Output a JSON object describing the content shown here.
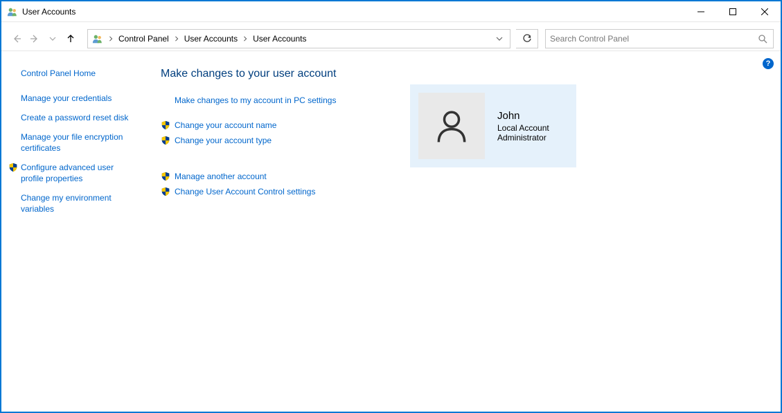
{
  "window": {
    "title": "User Accounts"
  },
  "breadcrumb": {
    "items": [
      "Control Panel",
      "User Accounts",
      "User Accounts"
    ]
  },
  "search": {
    "placeholder": "Search Control Panel"
  },
  "sidebar": {
    "home": "Control Panel Home",
    "links": [
      {
        "label": "Manage your credentials",
        "shield": false
      },
      {
        "label": "Create a password reset disk",
        "shield": false
      },
      {
        "label": "Manage your file encryption certificates",
        "shield": false
      },
      {
        "label": "Configure advanced user profile properties",
        "shield": true
      },
      {
        "label": "Change my environment variables",
        "shield": false
      }
    ]
  },
  "main": {
    "title": "Make changes to your user account",
    "pc_settings_link": "Make changes to my account in PC settings",
    "actions_group1": [
      {
        "label": "Change your account name",
        "shield": true
      },
      {
        "label": "Change your account type",
        "shield": true
      }
    ],
    "actions_group2": [
      {
        "label": "Manage another account",
        "shield": true
      },
      {
        "label": "Change User Account Control settings",
        "shield": true
      }
    ],
    "user": {
      "name": "John",
      "account_type": "Local Account",
      "role": "Administrator"
    }
  },
  "help_label": "?"
}
